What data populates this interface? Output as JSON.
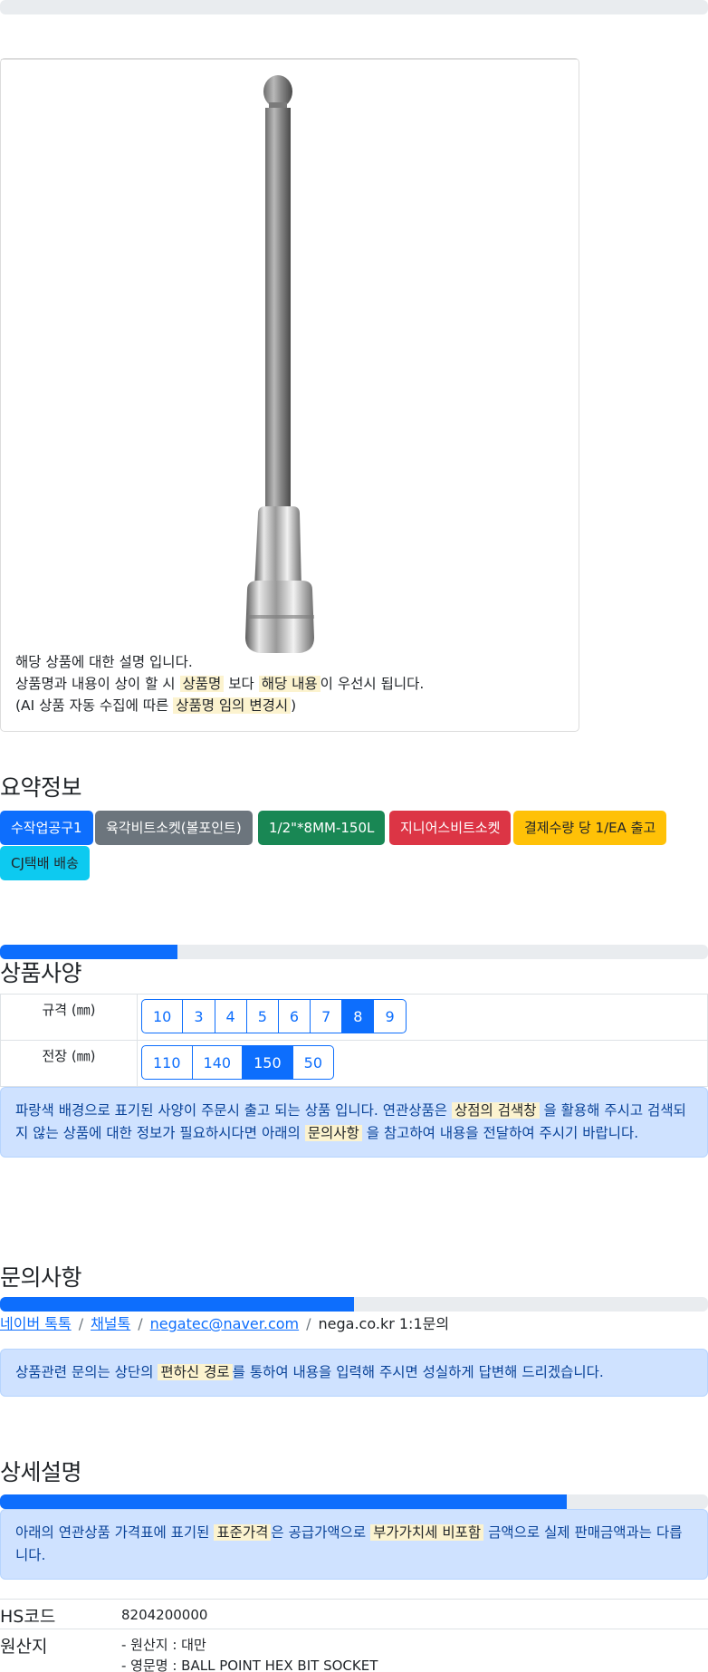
{
  "product": {
    "image_alt": "ball point hex bit socket",
    "desc_line1": "해당 상품에 대한 설명 입니다.",
    "desc_line2_a": "상품명과 내용이 상이 할 시",
    "desc_line2_mark1": "상품명",
    "desc_line2_b": "보다",
    "desc_line2_mark2": "해당 내용",
    "desc_line2_c": "이 우선시 됩니다.",
    "desc_line3_a": "(AI 상품 자동 수집에 따른",
    "desc_line3_mark": "상품명 임의 변경시",
    "desc_line3_b": ")"
  },
  "summary": {
    "title": "요약정보",
    "badges": [
      {
        "label": "수작업공구1",
        "color": "#0d6efd",
        "text_color": "#ffffff"
      },
      {
        "label": "육각비트소켓(볼포인트)",
        "color": "#6c757d",
        "text_color": "#ffffff"
      },
      {
        "label": "1/2\"*8MM-150L",
        "color": "#198754",
        "text_color": "#ffffff"
      },
      {
        "label": "지니어스비트소켓",
        "color": "#dc3545",
        "text_color": "#ffffff"
      },
      {
        "label": "결제수량 당 1/EA 출고",
        "color": "#ffc107",
        "text_color": "#212529"
      },
      {
        "label": "CJ택배 배송",
        "color": "#0dcaf0",
        "text_color": "#212529"
      }
    ]
  },
  "spec": {
    "title": "상품사양",
    "progress_percent": 25,
    "rows": [
      {
        "label": "규격 (㎜)",
        "options": [
          "10",
          "3",
          "4",
          "5",
          "6",
          "7",
          "8",
          "9"
        ],
        "selected": "8"
      },
      {
        "label": "전장 (㎜)",
        "options": [
          "110",
          "140",
          "150",
          "50"
        ],
        "selected": "150"
      }
    ],
    "notice_a": "파랑색 배경으로 표기된 사양이 주문시 출고 되는 상품 입니다. 연관상품은",
    "notice_mark1": "상점의 검색창",
    "notice_b": "을 활용해 주시고 검색되지 않는 상품에 대한 정보가 필요하시다면 아래의",
    "notice_mark2": "문의사항",
    "notice_c": "을 참고하여 내용을 전달하여 주시기 바랍니다."
  },
  "inquiry": {
    "title": "문의사항",
    "progress_percent": 50,
    "links": [
      "네이버 톡톡",
      "채널톡",
      "negatec@naver.com"
    ],
    "plain": "nega.co.kr 1:1문의",
    "separator": "/",
    "notice_a": "상품관련 문의는 상단의",
    "notice_mark": "편하신 경로",
    "notice_b": "를 통하여 내용을 입력해 주시면 성실하게 답변해 드리겠습니다."
  },
  "detail": {
    "title": "상세설명",
    "progress_percent": 80,
    "notice_a": "아래의 연관상품 가격표에 표기된",
    "notice_mark1": "표준가격",
    "notice_b": "은 공급가액으로",
    "notice_mark2": "부가가치세 비포함",
    "notice_c": "금액으로 실제 판매금액과는 다릅니다.",
    "hs_label": "HS코드",
    "hs_value": "8204200000",
    "origin_label": "원산지",
    "origin_line1": "- 원산지 : 대만",
    "origin_line2": "- 영문명 : BALL POINT HEX BIT SOCKET"
  }
}
